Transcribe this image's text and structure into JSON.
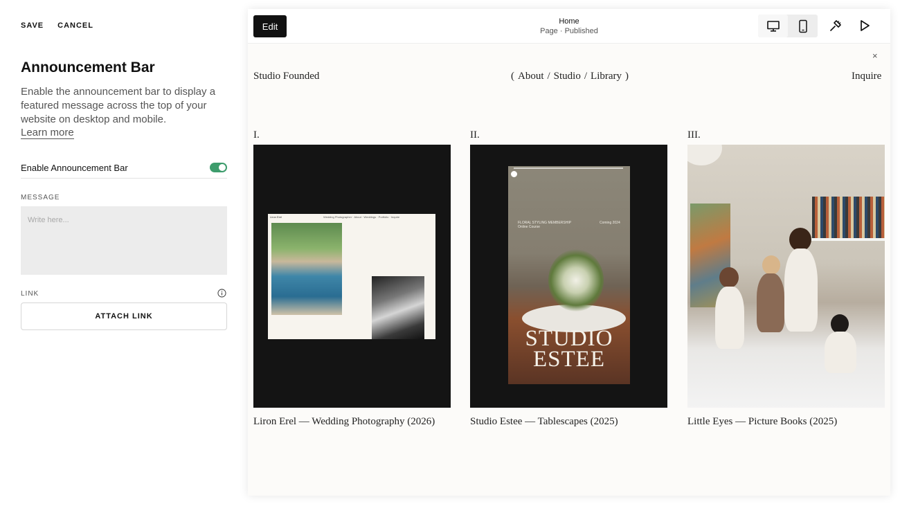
{
  "panel": {
    "save_label": "SAVE",
    "cancel_label": "CANCEL",
    "title": "Announcement Bar",
    "description": "Enable the announcement bar to display a featured message across the top of your website on desktop and mobile.",
    "learn_more": "Learn more",
    "toggle_label": "Enable Announcement Bar",
    "toggle_on": true,
    "message_label": "MESSAGE",
    "message_placeholder": "Write here...",
    "message_value": "",
    "link_label": "LINK",
    "attach_link": "ATTACH LINK"
  },
  "toolbar": {
    "edit_label": "Edit",
    "page_name": "Home",
    "page_status": "Page · Published",
    "active_view": "desktop"
  },
  "site": {
    "close_glyph": "×",
    "logo": "Studio Founded",
    "nav": {
      "open": "(",
      "items": [
        "About",
        "Studio",
        "Library"
      ],
      "separator": "/",
      "close": ")"
    },
    "inquire": "Inquire",
    "cards": [
      {
        "number": "I.",
        "caption": "Liron Erel — Wedding Photography (2026)",
        "mini_logo": "Liron Erel",
        "mini_nav": "Wedding Photographer · About · Weddings · Portfolio · Inquire"
      },
      {
        "number": "II.",
        "caption": "Studio Estee — Tablescapes (2025)",
        "mini_left": "FLORAL STYLING MEMBERSHIP\nOnline Course",
        "mini_right": "Coming 2024",
        "image_title_line1": "STUDIO",
        "image_title_line2": "ESTEE"
      },
      {
        "number": "III.",
        "caption": "Little Eyes — Picture Books (2025)"
      }
    ]
  },
  "colors": {
    "toggle_on": "#3d9c6c",
    "edit_button": "#111111",
    "preview_bg": "#fcfbf9",
    "card_bg": "#141414"
  }
}
